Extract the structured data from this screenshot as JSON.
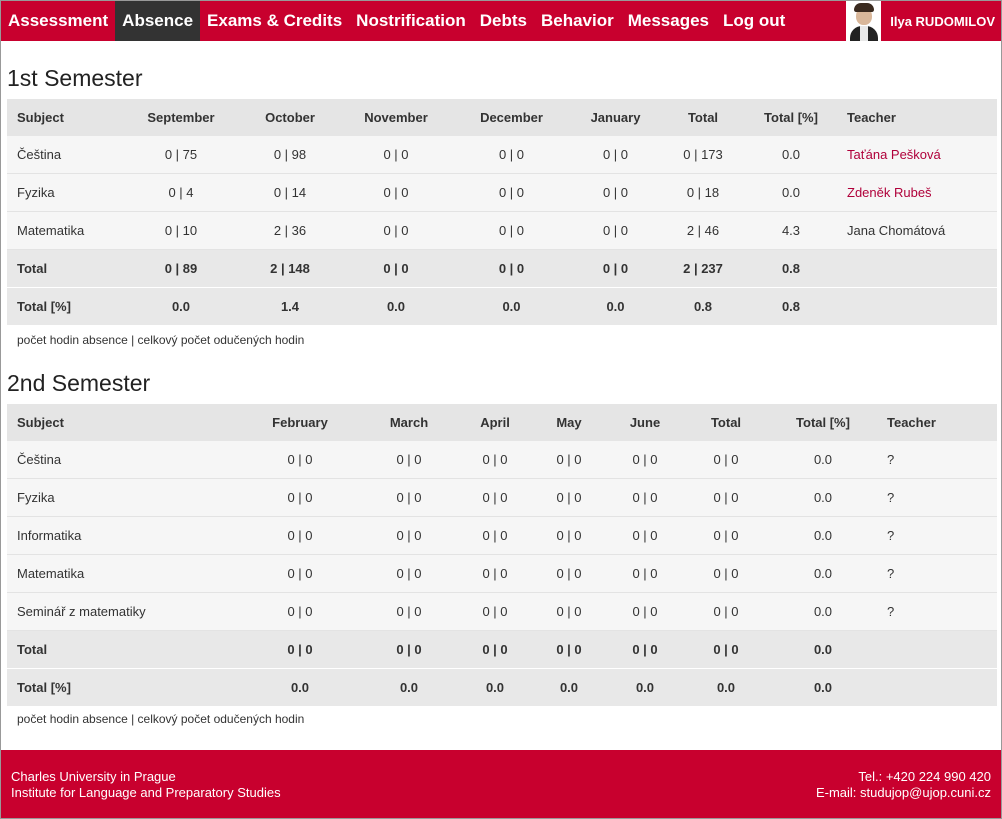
{
  "nav": {
    "items": [
      "Assessment",
      "Absence",
      "Exams & Credits",
      "Nostrification",
      "Debts",
      "Behavior",
      "Messages",
      "Log out"
    ],
    "active": "Absence",
    "user_name": "Ilya RUDOMILOV"
  },
  "semester1": {
    "title": "1st Semester",
    "headers": [
      "Subject",
      "September",
      "October",
      "November",
      "December",
      "January",
      "Total",
      "Total [%]",
      "Teacher"
    ],
    "rows": [
      [
        "Čeština",
        "0 | 75",
        "0 | 98",
        "0 | 0",
        "0 | 0",
        "0 | 0",
        "0 | 173",
        "0.0",
        "Taťána Pešková"
      ],
      [
        "Fyzika",
        "0 | 4",
        "0 | 14",
        "0 | 0",
        "0 | 0",
        "0 | 0",
        "0 | 18",
        "0.0",
        "Zdeněk Rubeš"
      ],
      [
        "Matematika",
        "0 | 10",
        "2 | 36",
        "0 | 0",
        "0 | 0",
        "0 | 0",
        "2 | 46",
        "4.3",
        "Jana Chomátová"
      ]
    ],
    "total_row": [
      "Total",
      "0 | 89",
      "2 | 148",
      "0 | 0",
      "0 | 0",
      "0 | 0",
      "2 | 237",
      "0.8",
      ""
    ],
    "percent_row": [
      "Total [%]",
      "0.0",
      "1.4",
      "0.0",
      "0.0",
      "0.0",
      "0.8",
      "0.8",
      ""
    ],
    "note": "počet hodin absence | celkový počet odučených hodin"
  },
  "semester2": {
    "title": "2nd Semester",
    "headers": [
      "Subject",
      "February",
      "March",
      "April",
      "May",
      "June",
      "Total",
      "Total [%]",
      "Teacher"
    ],
    "rows": [
      [
        "Čeština",
        "0 | 0",
        "0 | 0",
        "0 | 0",
        "0 | 0",
        "0 | 0",
        "0 | 0",
        "0.0",
        "?"
      ],
      [
        "Fyzika",
        "0 | 0",
        "0 | 0",
        "0 | 0",
        "0 | 0",
        "0 | 0",
        "0 | 0",
        "0.0",
        "?"
      ],
      [
        "Informatika",
        "0 | 0",
        "0 | 0",
        "0 | 0",
        "0 | 0",
        "0 | 0",
        "0 | 0",
        "0.0",
        "?"
      ],
      [
        "Matematika",
        "0 | 0",
        "0 | 0",
        "0 | 0",
        "0 | 0",
        "0 | 0",
        "0 | 0",
        "0.0",
        "?"
      ],
      [
        "Seminář z matematiky",
        "0 | 0",
        "0 | 0",
        "0 | 0",
        "0 | 0",
        "0 | 0",
        "0 | 0",
        "0.0",
        "?"
      ]
    ],
    "total_row": [
      "Total",
      "0 | 0",
      "0 | 0",
      "0 | 0",
      "0 | 0",
      "0 | 0",
      "0 | 0",
      "0.0",
      ""
    ],
    "percent_row": [
      "Total [%]",
      "0.0",
      "0.0",
      "0.0",
      "0.0",
      "0.0",
      "0.0",
      "0.0",
      ""
    ],
    "note": "počet hodin absence | celkový počet odučených hodin"
  },
  "footer": {
    "university": "Charles University in Prague",
    "institute": "Institute for Language and Preparatory Studies",
    "phone": "Tel.: +420 224 990 420",
    "email": "E-mail: studujop@ujop.cuni.cz"
  },
  "colors": {
    "brand_red": "#c8002e",
    "active_tab": "#333333",
    "teacher_link": "#b0003a"
  }
}
